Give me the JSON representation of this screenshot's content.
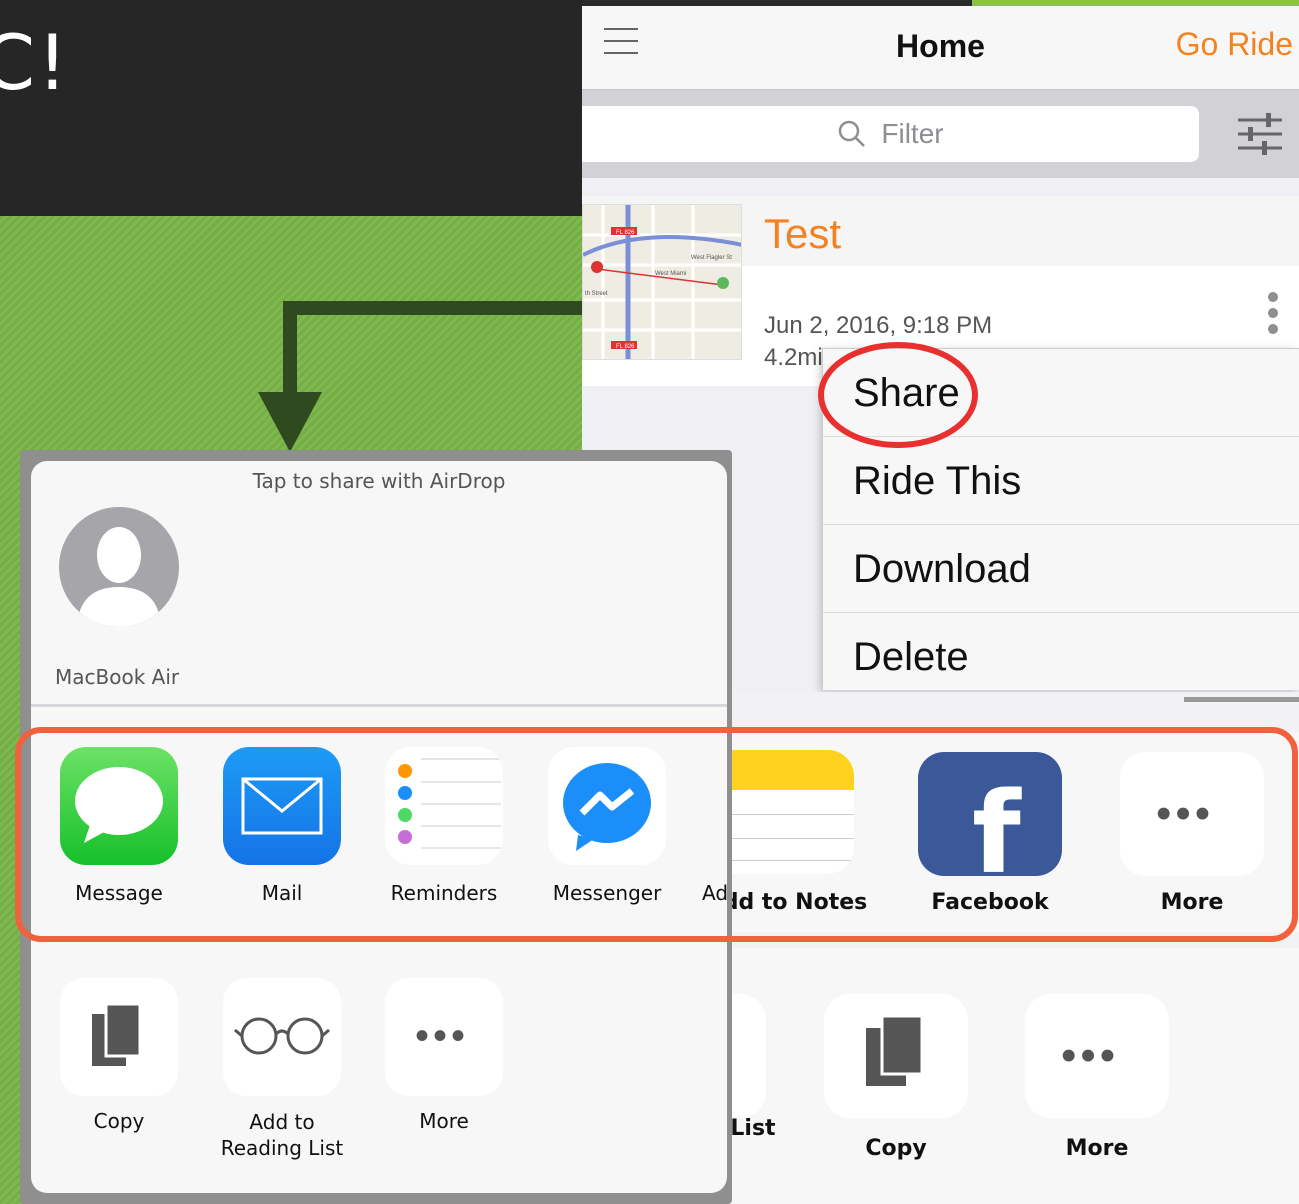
{
  "slide": {
    "title_fragment": "C!"
  },
  "app": {
    "nav_title": "Home",
    "go_ride_label": "Go Ride",
    "filter_placeholder": "Filter",
    "ride": {
      "title": "Test",
      "date": "Jun 2, 2016, 9:18 PM",
      "distance": "4.2mi",
      "map_labels": [
        "FL 826",
        "West Flagler St",
        "West Miami",
        "th Street",
        "FL 826"
      ]
    },
    "context_menu": [
      "Share",
      "Ride This",
      "Download",
      "Delete"
    ]
  },
  "left_share_sheet": {
    "airdrop_title": "Tap to share with AirDrop",
    "device_name": "MacBook Air",
    "apps": [
      "Message",
      "Mail",
      "Reminders",
      "Messenger",
      "Ad"
    ],
    "actions": [
      "Copy",
      "Add to\nReading List",
      "More"
    ]
  },
  "right_share_sheet": {
    "apps": [
      "dd to Notes",
      "Facebook",
      "More"
    ],
    "actions": [
      " List",
      "Copy",
      "More"
    ],
    "partial_label_top": ")"
  },
  "colors": {
    "accent_orange": "#f58220",
    "highlight_red": "#e8302f",
    "box_orange": "#f0623e",
    "slide_green": "#7fb84e",
    "slide_dark": "#262626"
  },
  "icons": [
    "hamburger-icon",
    "search-icon",
    "sliders-icon",
    "kebab-icon",
    "message-icon",
    "mail-icon",
    "reminders-icon",
    "messenger-icon",
    "notes-icon",
    "facebook-icon",
    "more-icon",
    "copy-icon",
    "glasses-icon"
  ]
}
